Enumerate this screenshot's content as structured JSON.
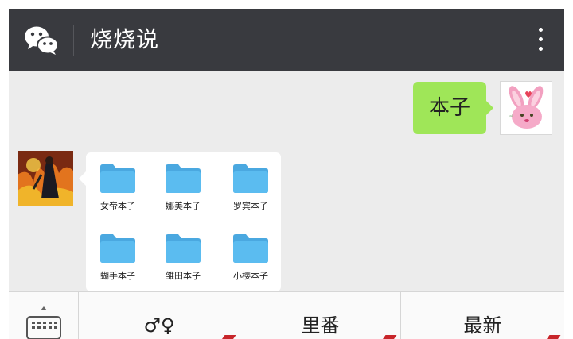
{
  "header": {
    "title": "烧烧说",
    "logo_icon": "wechat-logo-icon",
    "more_icon": "more-vertical-icon",
    "bar_color": "#393a3f"
  },
  "chat": {
    "sent_message": {
      "text": "本子",
      "bubble_color": "#9fe658",
      "avatar_icon": "pink-bunny-avatar"
    },
    "received_card": {
      "avatar_icon": "anime-character-avatar",
      "folders": [
        {
          "label": "女帝本子"
        },
        {
          "label": "娜美本子"
        },
        {
          "label": "罗宾本子"
        },
        {
          "label": "蝴手本子"
        },
        {
          "label": "雏田本子"
        },
        {
          "label": "小樱本子"
        }
      ],
      "folder_color": "#5bbcf0"
    }
  },
  "menu": {
    "keyboard_icon": "keyboard-icon",
    "items": [
      {
        "label": "♂♀"
      },
      {
        "label": "里番"
      },
      {
        "label": "最新"
      }
    ]
  }
}
